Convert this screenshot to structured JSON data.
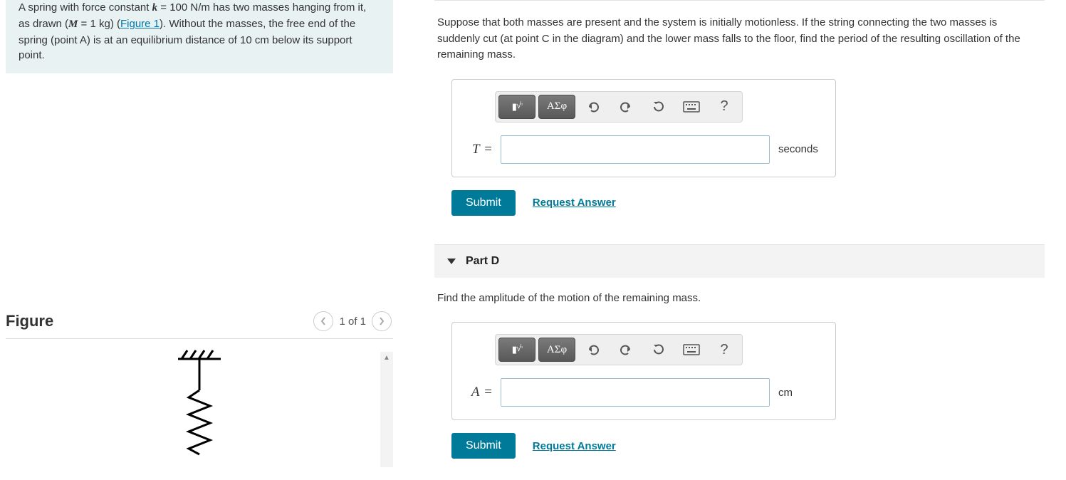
{
  "problem": {
    "text_prefix": "A spring with force constant ",
    "k_expr": "k",
    "k_val": " = 100 N/m has two masses hanging from it, as drawn (",
    "m_expr": "M",
    "m_val": " = 1 kg) (",
    "fig_link": "Figure 1",
    "text_suffix": "). Without the masses, the free end of the spring (point A) is at an equilibrium distance of 10 cm below its support point."
  },
  "figure": {
    "title": "Figure",
    "nav_label": "1 of 1"
  },
  "partC": {
    "question": "Suppose that both masses are present and the system is initially motionless. If the string connecting the two masses is suddenly cut (at point C in the diagram) and the lower mass falls to the floor, find the period of the resulting oscillation of the remaining mass.",
    "var": "T",
    "eq": " =",
    "unit": "seconds",
    "value": "",
    "toolbar_greek": "ΑΣφ",
    "submit": "Submit",
    "request": "Request Answer",
    "help": "?"
  },
  "partD": {
    "header": "Part D",
    "question": "Find the amplitude of the motion of the remaining mass.",
    "var": "A",
    "eq": " =",
    "unit": "cm",
    "value": "",
    "toolbar_greek": "ΑΣφ",
    "submit": "Submit",
    "request": "Request Answer",
    "help": "?"
  }
}
